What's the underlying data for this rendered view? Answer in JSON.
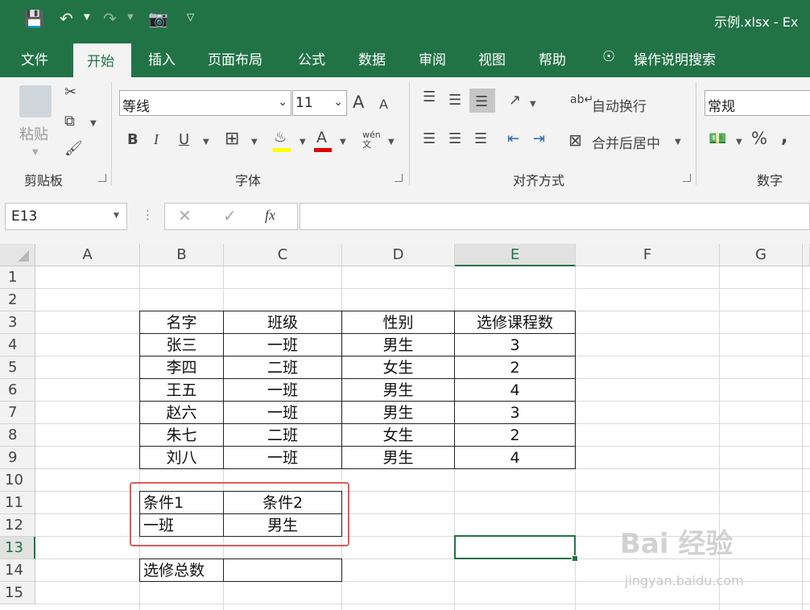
{
  "window": {
    "title": "示例.xlsx  -  Ex"
  },
  "ribbon_tabs": [
    "文件",
    "开始",
    "插入",
    "页面布局",
    "公式",
    "数据",
    "审阅",
    "视图",
    "帮助"
  ],
  "active_tab": "开始",
  "tell_me": "操作说明搜索",
  "clipboard": {
    "paste": "粘贴",
    "group": "剪贴板"
  },
  "font": {
    "name": "等线",
    "size": "11",
    "group": "字体",
    "bold": "B",
    "italic": "I",
    "underline": "U",
    "grow": "A",
    "shrink": "A",
    "font_color_letter": "A",
    "phonetic": "wén 文"
  },
  "alignment": {
    "wrap_text": "自动换行",
    "merge_center": "合并后居中",
    "group": "对齐方式"
  },
  "number": {
    "format": "常规",
    "group": "数字",
    "percent": "%",
    "comma": ","
  },
  "formula_bar": {
    "name_box": "E13",
    "fx": "fx",
    "formula": ""
  },
  "columns": [
    "A",
    "B",
    "C",
    "D",
    "E",
    "F",
    "G"
  ],
  "rows": [
    "1",
    "2",
    "3",
    "4",
    "5",
    "6",
    "7",
    "8",
    "9",
    "10",
    "11",
    "12",
    "13",
    "14",
    "15"
  ],
  "selected_cell": "E13",
  "table": {
    "headers": [
      "名字",
      "班级",
      "性别",
      "选修课程数"
    ],
    "rows": [
      [
        "张三",
        "一班",
        "男生",
        "3"
      ],
      [
        "李四",
        "二班",
        "女生",
        "2"
      ],
      [
        "王五",
        "一班",
        "男生",
        "4"
      ],
      [
        "赵六",
        "一班",
        "男生",
        "3"
      ],
      [
        "朱七",
        "二班",
        "女生",
        "2"
      ],
      [
        "刘八",
        "一班",
        "男生",
        "4"
      ]
    ]
  },
  "criteria": {
    "label1": "条件1",
    "label2": "条件2",
    "value1": "一班",
    "value2": "男生"
  },
  "total": {
    "label": "选修总数",
    "value": ""
  },
  "colors": {
    "excel_green": "#217346",
    "highlight_red": "#e05a5a"
  },
  "watermark": {
    "logo": "Bai 经验",
    "url": "jingyan.baidu.com"
  }
}
